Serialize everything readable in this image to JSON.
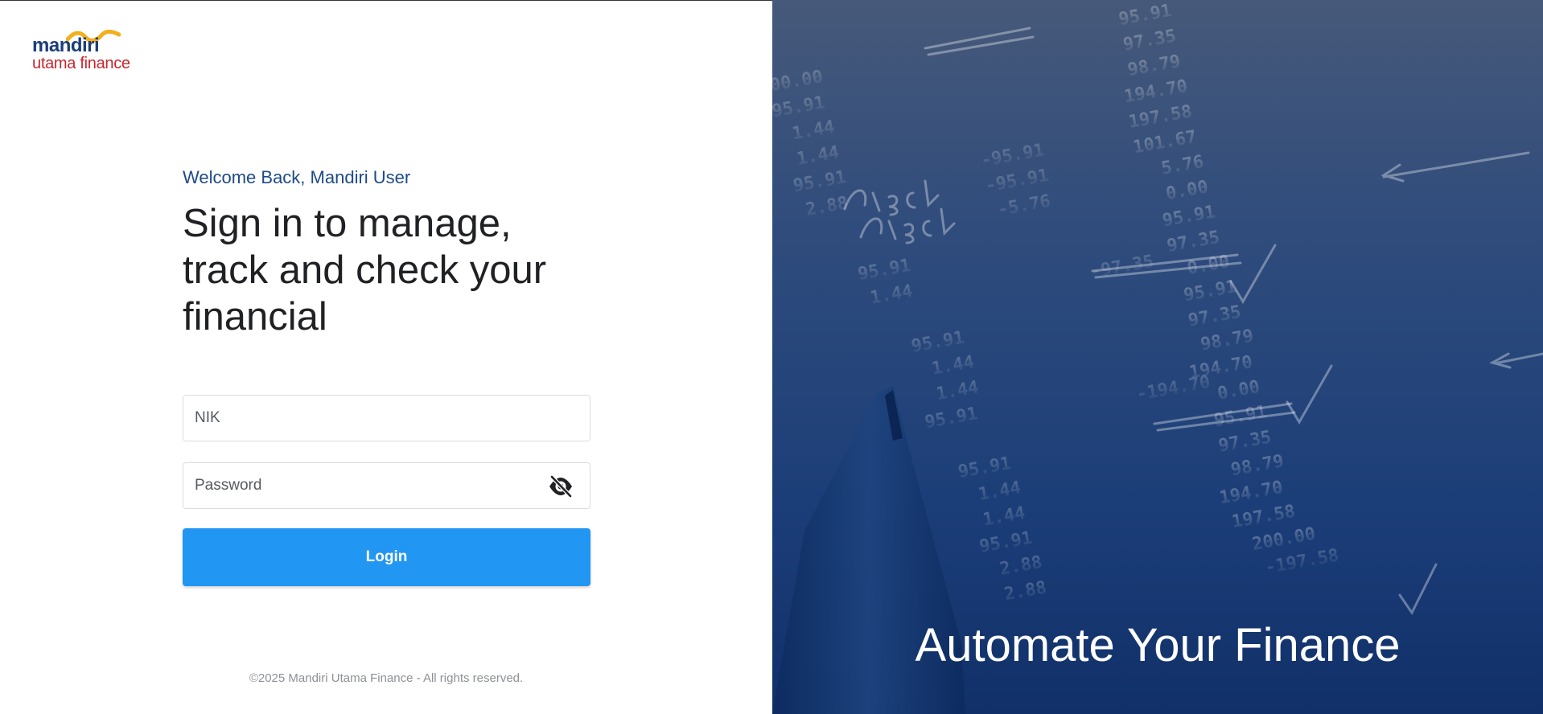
{
  "brand": {
    "name_top": "mandiri",
    "name_bottom": "utama finance",
    "colors": {
      "navy": "#1b3d7a",
      "red": "#c8262e",
      "gold": "#f2b01e"
    }
  },
  "login": {
    "welcome": "Welcome Back, Mandiri User",
    "headline": "Sign in to manage, track and check your financial",
    "nik_placeholder": "NIK",
    "password_placeholder": "Password",
    "password_toggle_icon": "eye-off-icon",
    "button_label": "Login",
    "button_color": "#2196f3"
  },
  "footer": {
    "copyright": "©2025 Mandiri Utama Finance - All rights reserved."
  },
  "hero": {
    "tagline": "Automate Your Finance",
    "overlay_color": "#1c3e78"
  }
}
